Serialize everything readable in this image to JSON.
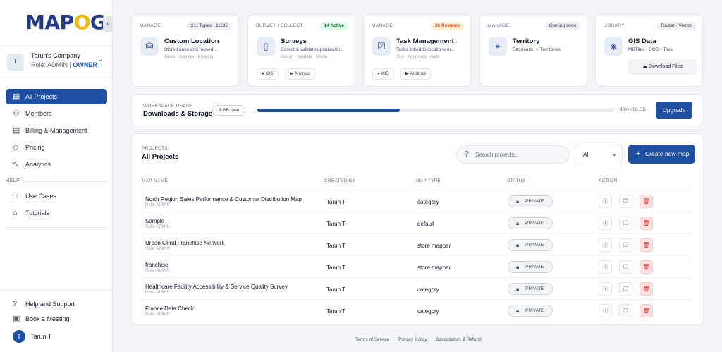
{
  "brand": {
    "logo_left": "MAP",
    "logo_mid": "O",
    "logo_right": "G"
  },
  "company": {
    "initial": "T",
    "name": "Tarun's Company",
    "role": "Role: ADMIN | ",
    "owner": "OWNER"
  },
  "nav": {
    "items": [
      {
        "label": "All Projects",
        "icon": "grid-icon",
        "active": true
      },
      {
        "label": "Members",
        "icon": "user-icon"
      },
      {
        "label": "Billing & Management",
        "icon": "receipt-icon"
      },
      {
        "label": "Pricing",
        "icon": "tag-icon"
      },
      {
        "label": "Analytics",
        "icon": "trend-icon"
      }
    ],
    "help_label": "HELP",
    "help_items": [
      {
        "label": "Use Cases",
        "icon": "book-icon"
      },
      {
        "label": "Tutorials",
        "icon": "graduation-cap-icon"
      }
    ],
    "bottom_items": [
      {
        "label": "Help and Support",
        "icon": "help-circle-icon"
      },
      {
        "label": "Book a Meeting",
        "icon": "calendar-icon"
      }
    ]
  },
  "user": {
    "initial": "T",
    "name": "Tarun T"
  },
  "cards": [
    {
      "category": "MANAGE",
      "badge": "211 Types · 11135",
      "title": "Custom Location",
      "sub": "Stored once and reused...",
      "sub2": "Tasks · Surveys · Projects",
      "icon": "database-icon"
    },
    {
      "category": "SURVEY / COLLECT",
      "badge": "14 Active",
      "title": "Surveys",
      "sub": "Collect & validate updates for...",
      "sub2": "Assign · Validate · Media",
      "icon": "clipboard-icon",
      "ios": "iOS",
      "android": "Android"
    },
    {
      "category": "MANAGE",
      "badge": "36 Reviews",
      "title": "Task Management",
      "sub": "Tasks linked to locations or...",
      "sub2": "SLA · Approvals · Audit",
      "icon": "checkbox-icon",
      "ios": "iOS",
      "android": "Android"
    },
    {
      "category": "MANAGE",
      "badge": "Coming soon",
      "title": "Territory",
      "sub": "Segments → Territories",
      "icon": "map-pin-icon"
    },
    {
      "category": "LIBRARY",
      "badge": "Raster · Vector",
      "title": "GIS Data",
      "sub": "MBTiles · COG · Tiles",
      "icon": "layers-icon",
      "button": "Download Files"
    }
  ],
  "usage": {
    "label": "WORKSPACE USAGE",
    "title": "Downloads & Storage",
    "total": "8 GB total",
    "percent": 40,
    "percent_text": "40% of 8 GB",
    "upgrade": "Upgrade"
  },
  "projects": {
    "label": "PROJECTS",
    "title": "All Projects",
    "search_placeholder": "Search projects...",
    "filter": "All",
    "new_button": "Create new map",
    "columns": [
      "MAP NAME",
      "CREATED BY",
      "MAP TYPE",
      "STATUS",
      "ACTION"
    ],
    "rows": [
      {
        "name": "North Region Sales Performance & Customer Distribution Map",
        "role": "Role: ADMIN",
        "created_by": "Tarun T",
        "type": "category",
        "status": "PRIVATE"
      },
      {
        "name": "Sample",
        "role": "Role: ADMIN",
        "created_by": "Tarun T",
        "type": "default",
        "status": "PRIVATE"
      },
      {
        "name": "Urban Grind Franchise Network",
        "role": "Role: ADMIN",
        "created_by": "Tarun T",
        "type": "store mapper",
        "status": "PRIVATE"
      },
      {
        "name": "franchise",
        "role": "Role: ADMIN",
        "created_by": "Tarun T",
        "type": "store mapper",
        "status": "PRIVATE"
      },
      {
        "name": "Healthcare Facility Accessibility & Service Quality Survey",
        "role": "Role: ADMIN",
        "created_by": "Tarun T",
        "type": "category",
        "status": "PRIVATE"
      },
      {
        "name": "France Data Check",
        "role": "Role: ADMIN",
        "created_by": "Tarun T",
        "type": "category",
        "status": "PRIVATE"
      }
    ]
  },
  "footer": {
    "terms": "Terms of Service",
    "privacy": "Privacy Policy",
    "refund": "Cancellation & Refund"
  }
}
